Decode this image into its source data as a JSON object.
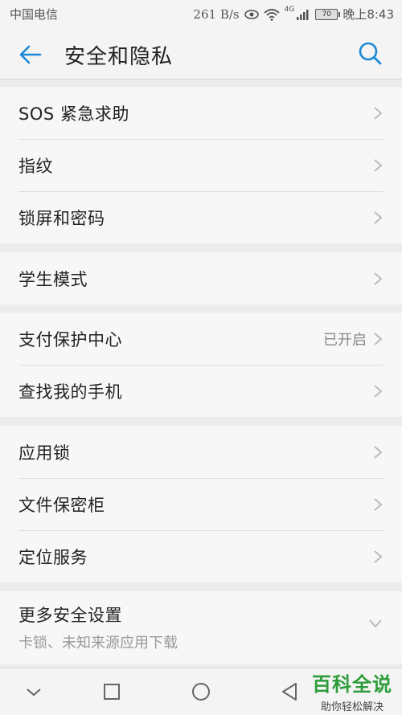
{
  "status": {
    "carrier": "中国电信",
    "speed": "261 B/s",
    "network": "4G",
    "battery": "70",
    "time": "晚上8:43"
  },
  "header": {
    "title": "安全和隐私",
    "back_icon": "arrow-left-icon",
    "search_icon": "search-icon"
  },
  "groups": [
    {
      "items": [
        {
          "label": "SOS 紧急求助"
        },
        {
          "label": "指纹"
        },
        {
          "label": "锁屏和密码"
        }
      ]
    },
    {
      "items": [
        {
          "label": "学生模式"
        }
      ]
    },
    {
      "items": [
        {
          "label": "支付保护中心",
          "value": "已开启"
        },
        {
          "label": "查找我的手机"
        }
      ]
    },
    {
      "items": [
        {
          "label": "应用锁"
        },
        {
          "label": "文件保密柜"
        },
        {
          "label": "定位服务"
        }
      ]
    },
    {
      "items": [
        {
          "label": "更多安全设置",
          "subtitle": "卡锁、未知来源应用下载"
        }
      ]
    }
  ],
  "nav": {
    "collapse_icon": "chevron-down-icon",
    "recents_icon": "square-icon",
    "home_icon": "circle-icon",
    "back_icon": "triangle-back-icon"
  },
  "watermark": {
    "main": "百科全说",
    "sub": "助你轻松解决"
  },
  "colors": {
    "accent": "#1e88d8",
    "watermark_green": "#2e9c3a"
  }
}
